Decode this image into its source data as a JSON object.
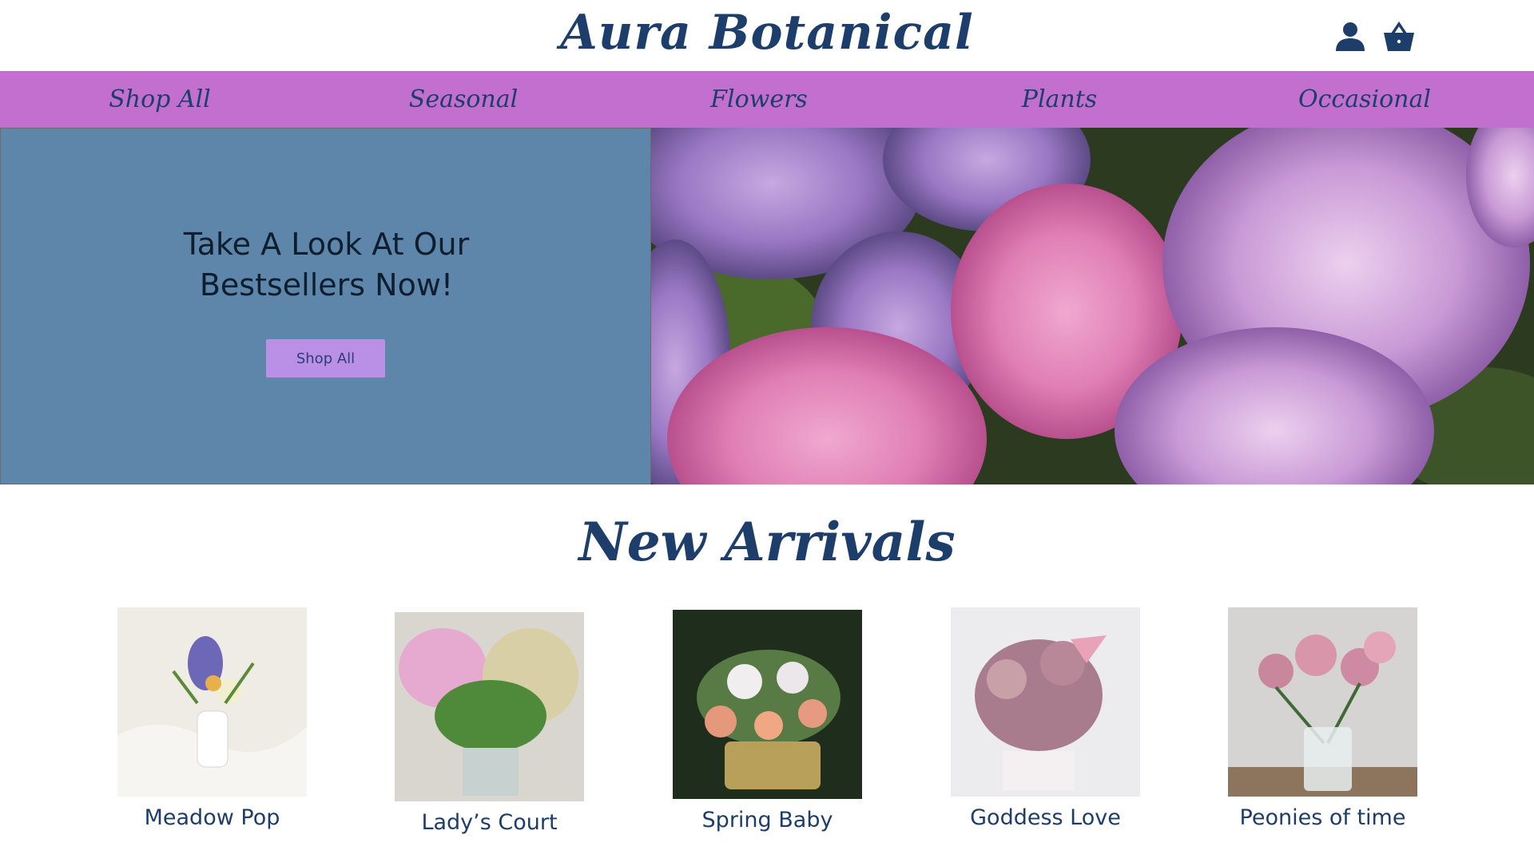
{
  "header": {
    "logo": "Aura Botanical",
    "account_icon": "user-icon",
    "cart_icon": "shopping-basket-icon"
  },
  "nav": {
    "items": [
      {
        "label": "Shop All"
      },
      {
        "label": "Seasonal"
      },
      {
        "label": "Flowers"
      },
      {
        "label": "Plants"
      },
      {
        "label": "Occasional"
      }
    ]
  },
  "hero": {
    "heading_line1": "Take A Look At Our",
    "heading_line2": "Bestsellers Now!",
    "button_label": "Shop All",
    "image": "hydrangea-photo"
  },
  "new_arrivals": {
    "title": "New Arrivals",
    "products": [
      {
        "name": "Meadow Pop"
      },
      {
        "name": "Lady’s Court"
      },
      {
        "name": "Spring Baby"
      },
      {
        "name": "Goddess Love"
      },
      {
        "name": "Peonies of time"
      }
    ]
  },
  "colors": {
    "nav_bg": "#c36fd0",
    "hero_panel_bg": "#5d86aa",
    "button_bg": "#b990e6",
    "brand_text": "#1d3d6b"
  }
}
